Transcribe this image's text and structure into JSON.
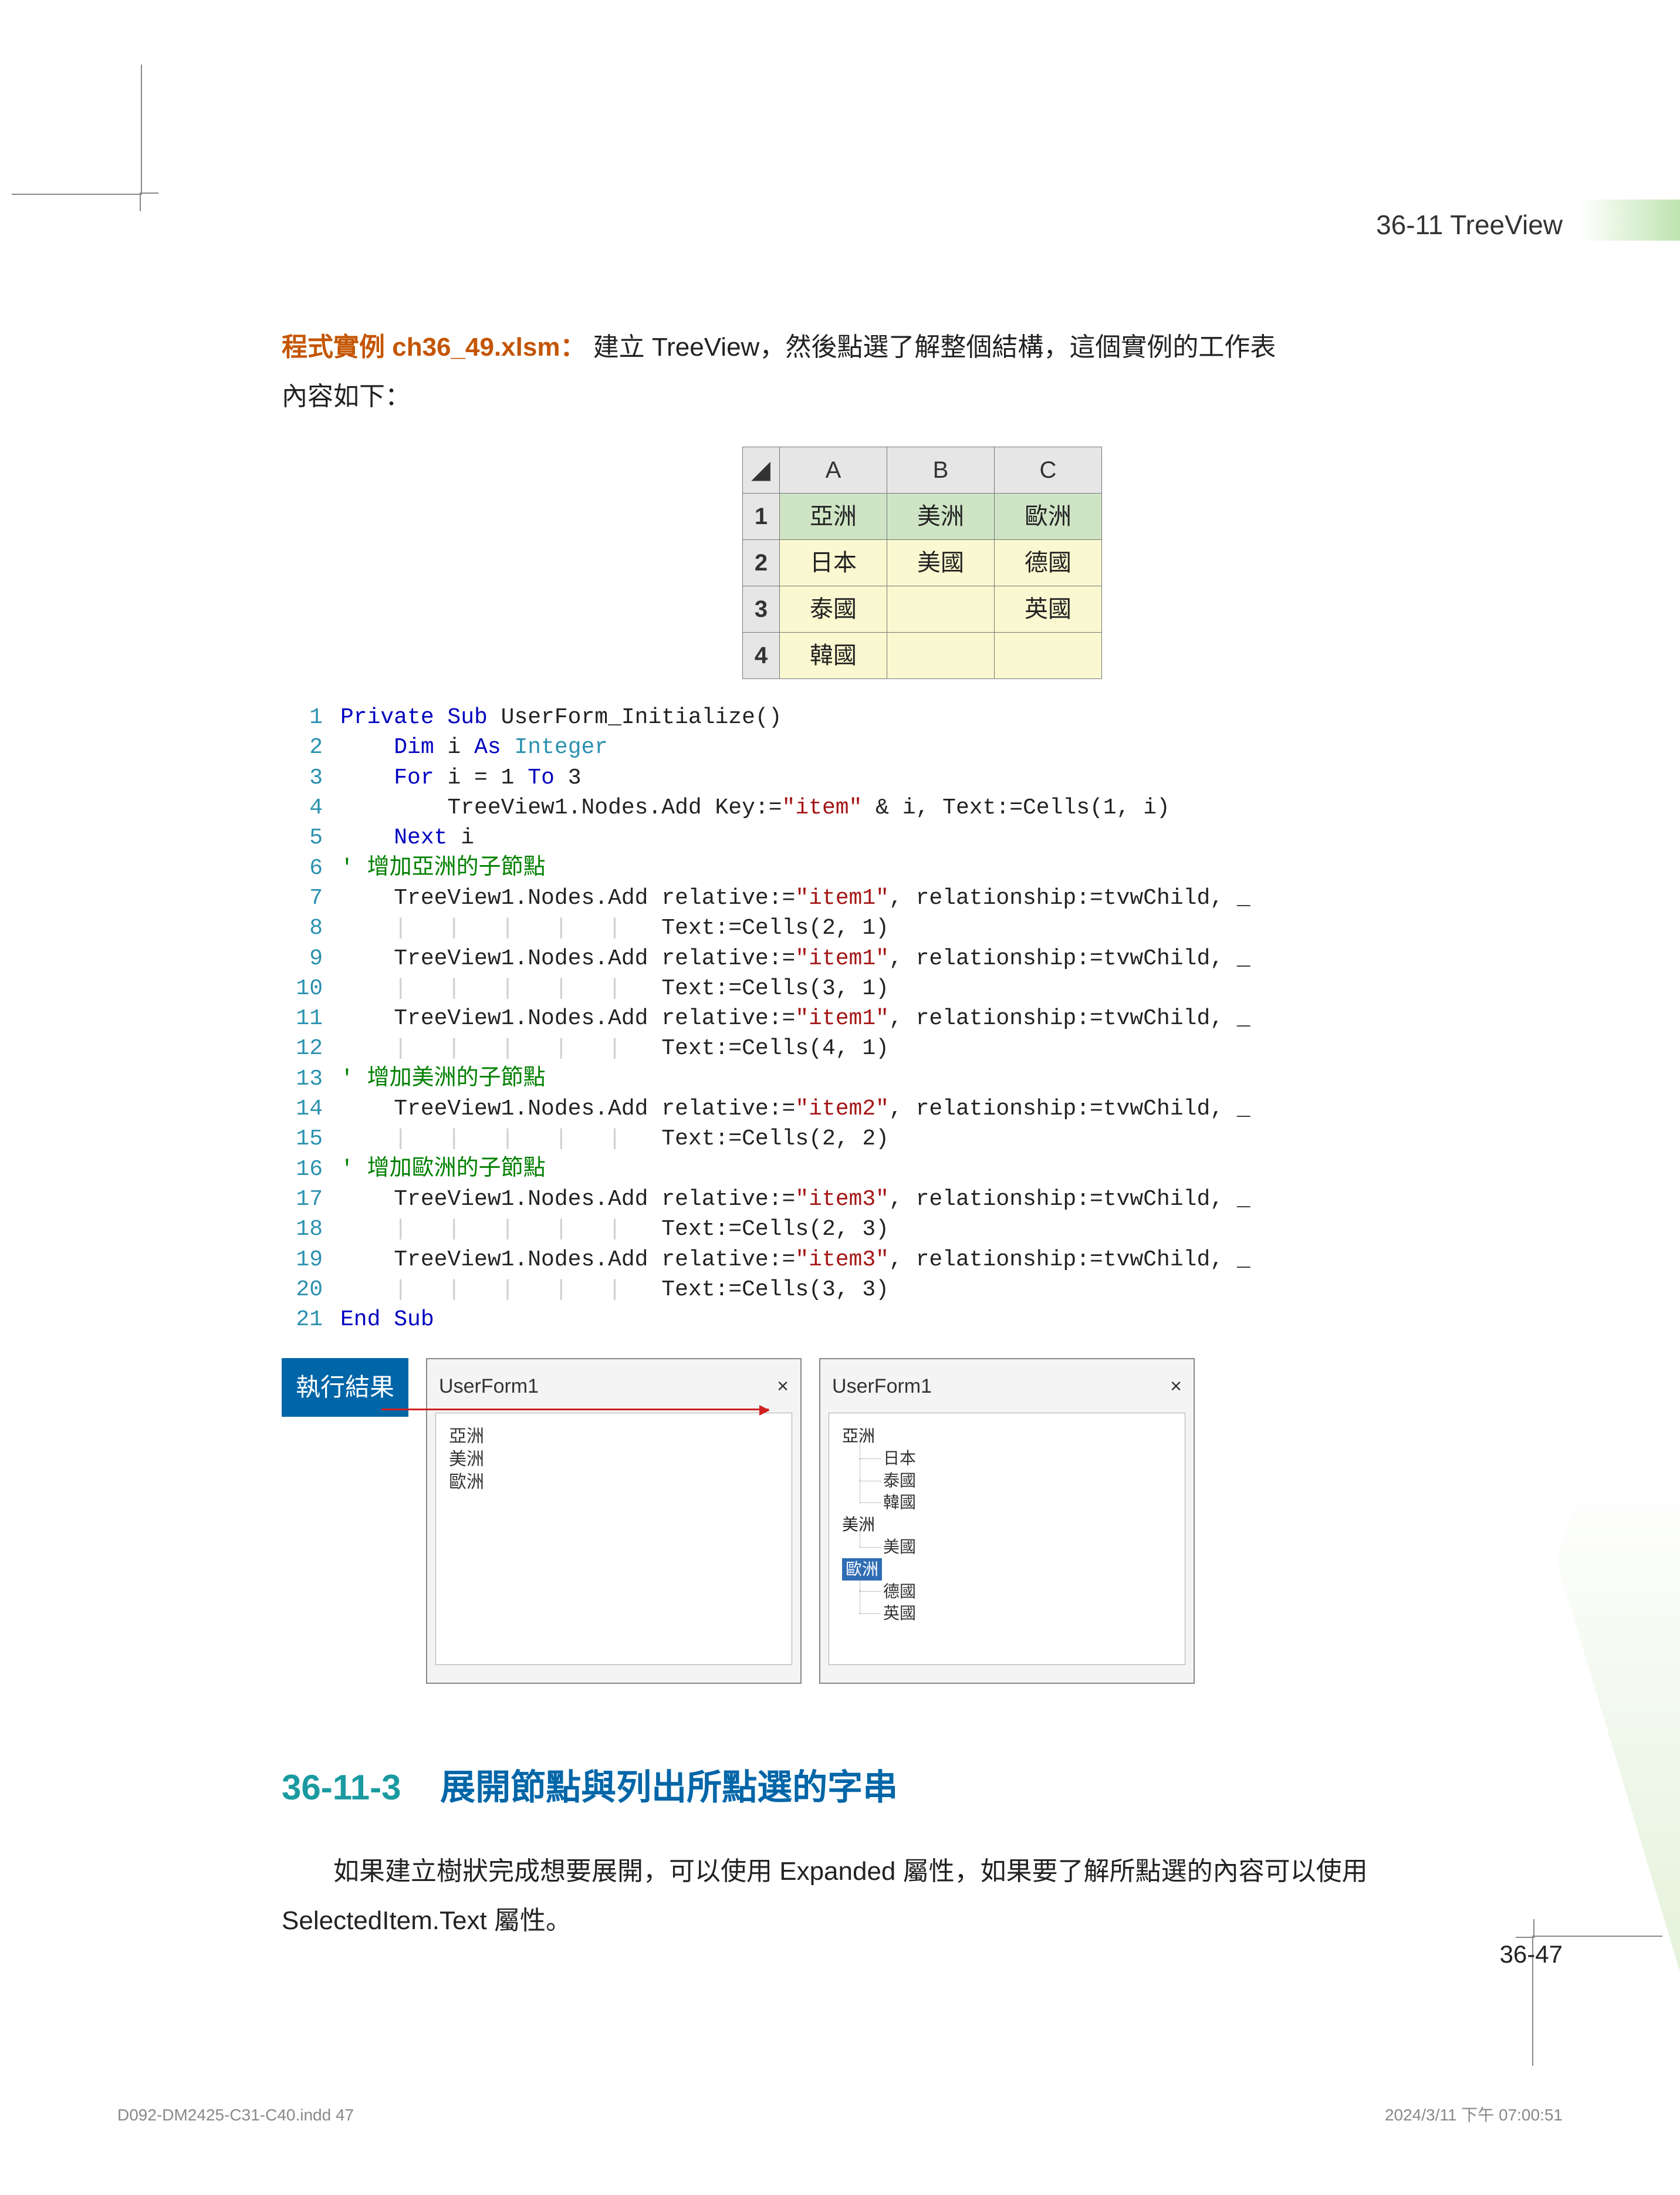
{
  "header": {
    "running": "36-11  TreeView"
  },
  "intro": {
    "label": "程式實例 ch36_49.xlsm：",
    "text1": "建立 TreeView，然後點選了解整個結構，這個實例的工作表",
    "text2": "內容如下："
  },
  "excel": {
    "cols": [
      "A",
      "B",
      "C"
    ],
    "rows": [
      "1",
      "2",
      "3",
      "4"
    ],
    "data": [
      [
        "亞洲",
        "美洲",
        "歐洲"
      ],
      [
        "日本",
        "美國",
        "德國"
      ],
      [
        "泰國",
        "",
        "英國"
      ],
      [
        "韓國",
        "",
        ""
      ]
    ]
  },
  "code": {
    "lines": [
      {
        "n": "1",
        "html": "<span class='kw'>Private Sub</span> UserForm_Initialize()"
      },
      {
        "n": "2",
        "html": "    <span class='kw'>Dim</span> i <span class='kw'>As</span> <span class='ty'>Integer</span>"
      },
      {
        "n": "3",
        "html": "    <span class='kw'>For</span> i = 1 <span class='kw'>To</span> 3"
      },
      {
        "n": "4",
        "html": "        TreeView1.Nodes.Add Key:=<span class='st'>\"item\"</span> &amp; i, Text:=Cells(1, i)"
      },
      {
        "n": "5",
        "html": "    <span class='kw'>Next</span> i"
      },
      {
        "n": "6",
        "html": "<span class='cm'>' 增加亞洲的子節點</span>"
      },
      {
        "n": "7",
        "html": "    TreeView1.Nodes.Add relative:=<span class='st'>\"item1\"</span>, relationship:=tvwChild, _"
      },
      {
        "n": "8",
        "html": "    <span class='pipe'>|   |   |   |   |</span>   Text:=Cells(2, 1)"
      },
      {
        "n": "9",
        "html": "    TreeView1.Nodes.Add relative:=<span class='st'>\"item1\"</span>, relationship:=tvwChild, _"
      },
      {
        "n": "10",
        "html": "    <span class='pipe'>|   |   |   |   |</span>   Text:=Cells(3, 1)"
      },
      {
        "n": "11",
        "html": "    TreeView1.Nodes.Add relative:=<span class='st'>\"item1\"</span>, relationship:=tvwChild, _"
      },
      {
        "n": "12",
        "html": "    <span class='pipe'>|   |   |   |   |</span>   Text:=Cells(4, 1)"
      },
      {
        "n": "13",
        "html": "<span class='cm'>' 增加美洲的子節點</span>"
      },
      {
        "n": "14",
        "html": "    TreeView1.Nodes.Add relative:=<span class='st'>\"item2\"</span>, relationship:=tvwChild, _"
      },
      {
        "n": "15",
        "html": "    <span class='pipe'>|   |   |   |   |</span>   Text:=Cells(2, 2)"
      },
      {
        "n": "16",
        "html": "<span class='cm'>' 增加歐洲的子節點</span>"
      },
      {
        "n": "17",
        "html": "    TreeView1.Nodes.Add relative:=<span class='st'>\"item3\"</span>, relationship:=tvwChild, _"
      },
      {
        "n": "18",
        "html": "    <span class='pipe'>|   |   |   |   |</span>   Text:=Cells(2, 3)"
      },
      {
        "n": "19",
        "html": "    TreeView1.Nodes.Add relative:=<span class='st'>\"item3\"</span>, relationship:=tvwChild, _"
      },
      {
        "n": "20",
        "html": "    <span class='pipe'>|   |   |   |   |</span>   Text:=Cells(3, 3)"
      },
      {
        "n": "21",
        "html": "<span class='kw'>End Sub</span>"
      }
    ]
  },
  "results": {
    "badge": "執行結果",
    "uf_title": "UserForm1",
    "close": "×",
    "left_tree": [
      "亞洲",
      "美洲",
      "歐洲"
    ],
    "right_tree": {
      "r0": "亞洲",
      "r0_children": [
        "日本",
        "泰國",
        "韓國"
      ],
      "r1": "美洲",
      "r1_children": [
        "美國"
      ],
      "r2": "歐洲",
      "r2_children": [
        "德國",
        "英國"
      ]
    }
  },
  "section": {
    "number": "36-11-3",
    "title": "展開節點與列出所點選的字串",
    "para": "如果建立樹狀完成想要展開，可以使用 Expanded 屬性，如果要了解所點選的內容可以使用 SelectedItem.Text 屬性。"
  },
  "page_number": "36-47",
  "footer": {
    "left": "D092-DM2425-C31-C40.indd   47",
    "right": "2024/3/11   下午 07:00:51"
  }
}
